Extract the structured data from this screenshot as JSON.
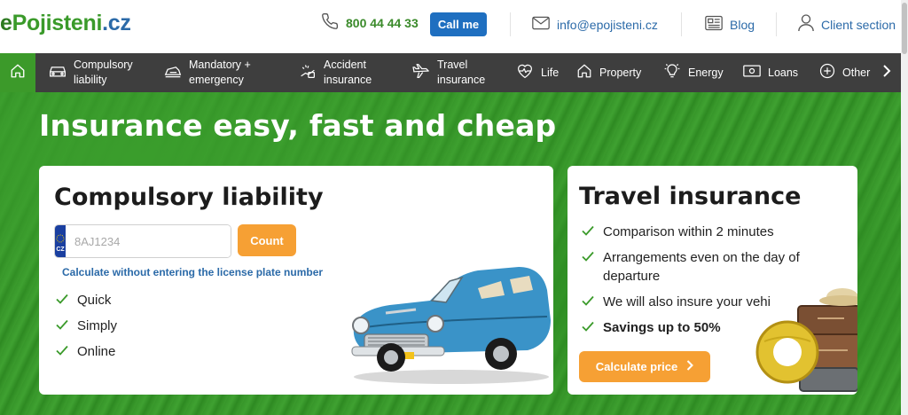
{
  "header": {
    "logo": {
      "prefix": "e",
      "brand": "Pojisteni",
      "suffix": ".cz"
    },
    "phone": {
      "icon": "phone-icon",
      "number": "800 44 44 33"
    },
    "call_button": "Call me",
    "email": {
      "icon": "mail-icon",
      "text": "info@epojisteni.cz"
    },
    "blog": {
      "icon": "newspaper-icon",
      "text": "Blog"
    },
    "client": {
      "icon": "user-icon",
      "text": "Client section"
    }
  },
  "nav": {
    "home_icon": "home-icon",
    "items": [
      {
        "icon": "car-icon",
        "label": "Compulsory\nliability"
      },
      {
        "icon": "car-crash-icon",
        "label": "Mandatory +\nemergency"
      },
      {
        "icon": "accident-icon",
        "label": "Accident\ninsurance"
      },
      {
        "icon": "plane-icon",
        "label": "Travel\ninsurance"
      },
      {
        "icon": "heartbeat-icon",
        "label": "Life"
      },
      {
        "icon": "house-icon",
        "label": "Property"
      },
      {
        "icon": "bulb-icon",
        "label": "Energy"
      },
      {
        "icon": "money-icon",
        "label": "Loans"
      },
      {
        "icon": "plus-circle-icon",
        "label": "Other"
      }
    ]
  },
  "hero": {
    "title": "Insurance easy, fast and cheap",
    "liability": {
      "title": "Compulsory liability",
      "plate_country": "CZ",
      "plate_placeholder": "8AJ1234",
      "count_button": "Count",
      "calc_link": "Calculate without entering the license plate number",
      "benefits": [
        "Quick",
        "Simply",
        "Online"
      ]
    },
    "travel": {
      "title": "Travel insurance",
      "benefits": [
        "Comparison within 2 minutes",
        "Arrangements even on the day of departure",
        "We will also insure your vehi",
        "Savings up to 50%"
      ],
      "button": "Calculate price"
    }
  },
  "colors": {
    "brand_green": "#3a9a2a",
    "link_blue": "#2b6aa8",
    "button_blue": "#1f6fc0",
    "accent_orange": "#f6a034",
    "nav_dark": "#3e3e3e"
  }
}
